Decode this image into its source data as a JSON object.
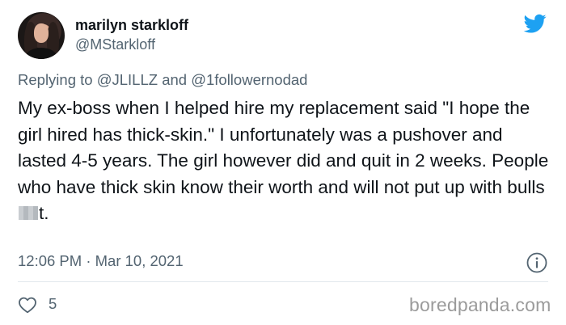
{
  "author": {
    "display_name": "marilyn starkloff",
    "handle": "@MStarkloff"
  },
  "reply": {
    "prefix": "Replying to",
    "mention1": "@JLILLZ",
    "conjunction": "and",
    "mention2": "@1followernodad"
  },
  "tweet": {
    "text_main": "My ex-boss when I helped hire my replacement said \"I hope the girl hired has thick-skin.\" I unfortunately was a pushover and lasted 4-5 years. The girl however did and quit in 2 weeks. People who have thick skin know their worth and will not put up with bulls",
    "text_end": "t."
  },
  "meta": {
    "timestamp": "12:06 PM · Mar 10, 2021"
  },
  "engagement": {
    "likes": "5"
  },
  "watermark": "boredpanda.com",
  "colors": {
    "twitter_blue": "#1da1f2",
    "secondary_text": "#536471"
  },
  "icons": {
    "brand": "twitter-bird-icon",
    "info": "info-icon",
    "like": "heart-icon"
  }
}
